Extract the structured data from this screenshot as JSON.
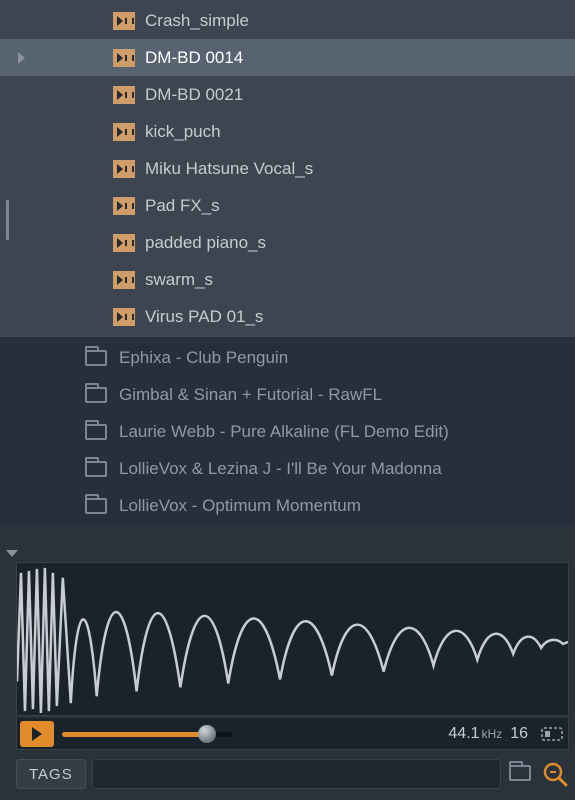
{
  "samples": [
    {
      "name": "Crash_simple",
      "selected": false
    },
    {
      "name": "DM-BD 0014",
      "selected": true
    },
    {
      "name": "DM-BD 0021",
      "selected": false
    },
    {
      "name": "kick_puch",
      "selected": false
    },
    {
      "name": "Miku Hatsune Vocal_s",
      "selected": false
    },
    {
      "name": "Pad FX_s",
      "selected": false
    },
    {
      "name": "padded piano_s",
      "selected": false
    },
    {
      "name": "swarm_s",
      "selected": false
    },
    {
      "name": "Virus PAD 01_s",
      "selected": false
    }
  ],
  "folders": [
    {
      "name": "Ephixa - Club Penguin"
    },
    {
      "name": "Gimbal & Sinan + Futorial - RawFL"
    },
    {
      "name": "Laurie Webb - Pure Alkaline (FL Demo Edit)"
    },
    {
      "name": "LollieVox & Lezina J - I'll Be Your Madonna"
    },
    {
      "name": "LollieVox - Optimum Momentum"
    }
  ],
  "preview": {
    "sample_rate_value": "44.1",
    "sample_rate_unit": "kHz",
    "bit_depth_value": "16",
    "bit_depth_unit": ""
  },
  "bottom": {
    "tags_label": "TAGS",
    "search_placeholder": ""
  },
  "colors": {
    "accent": "#e18b2a"
  }
}
